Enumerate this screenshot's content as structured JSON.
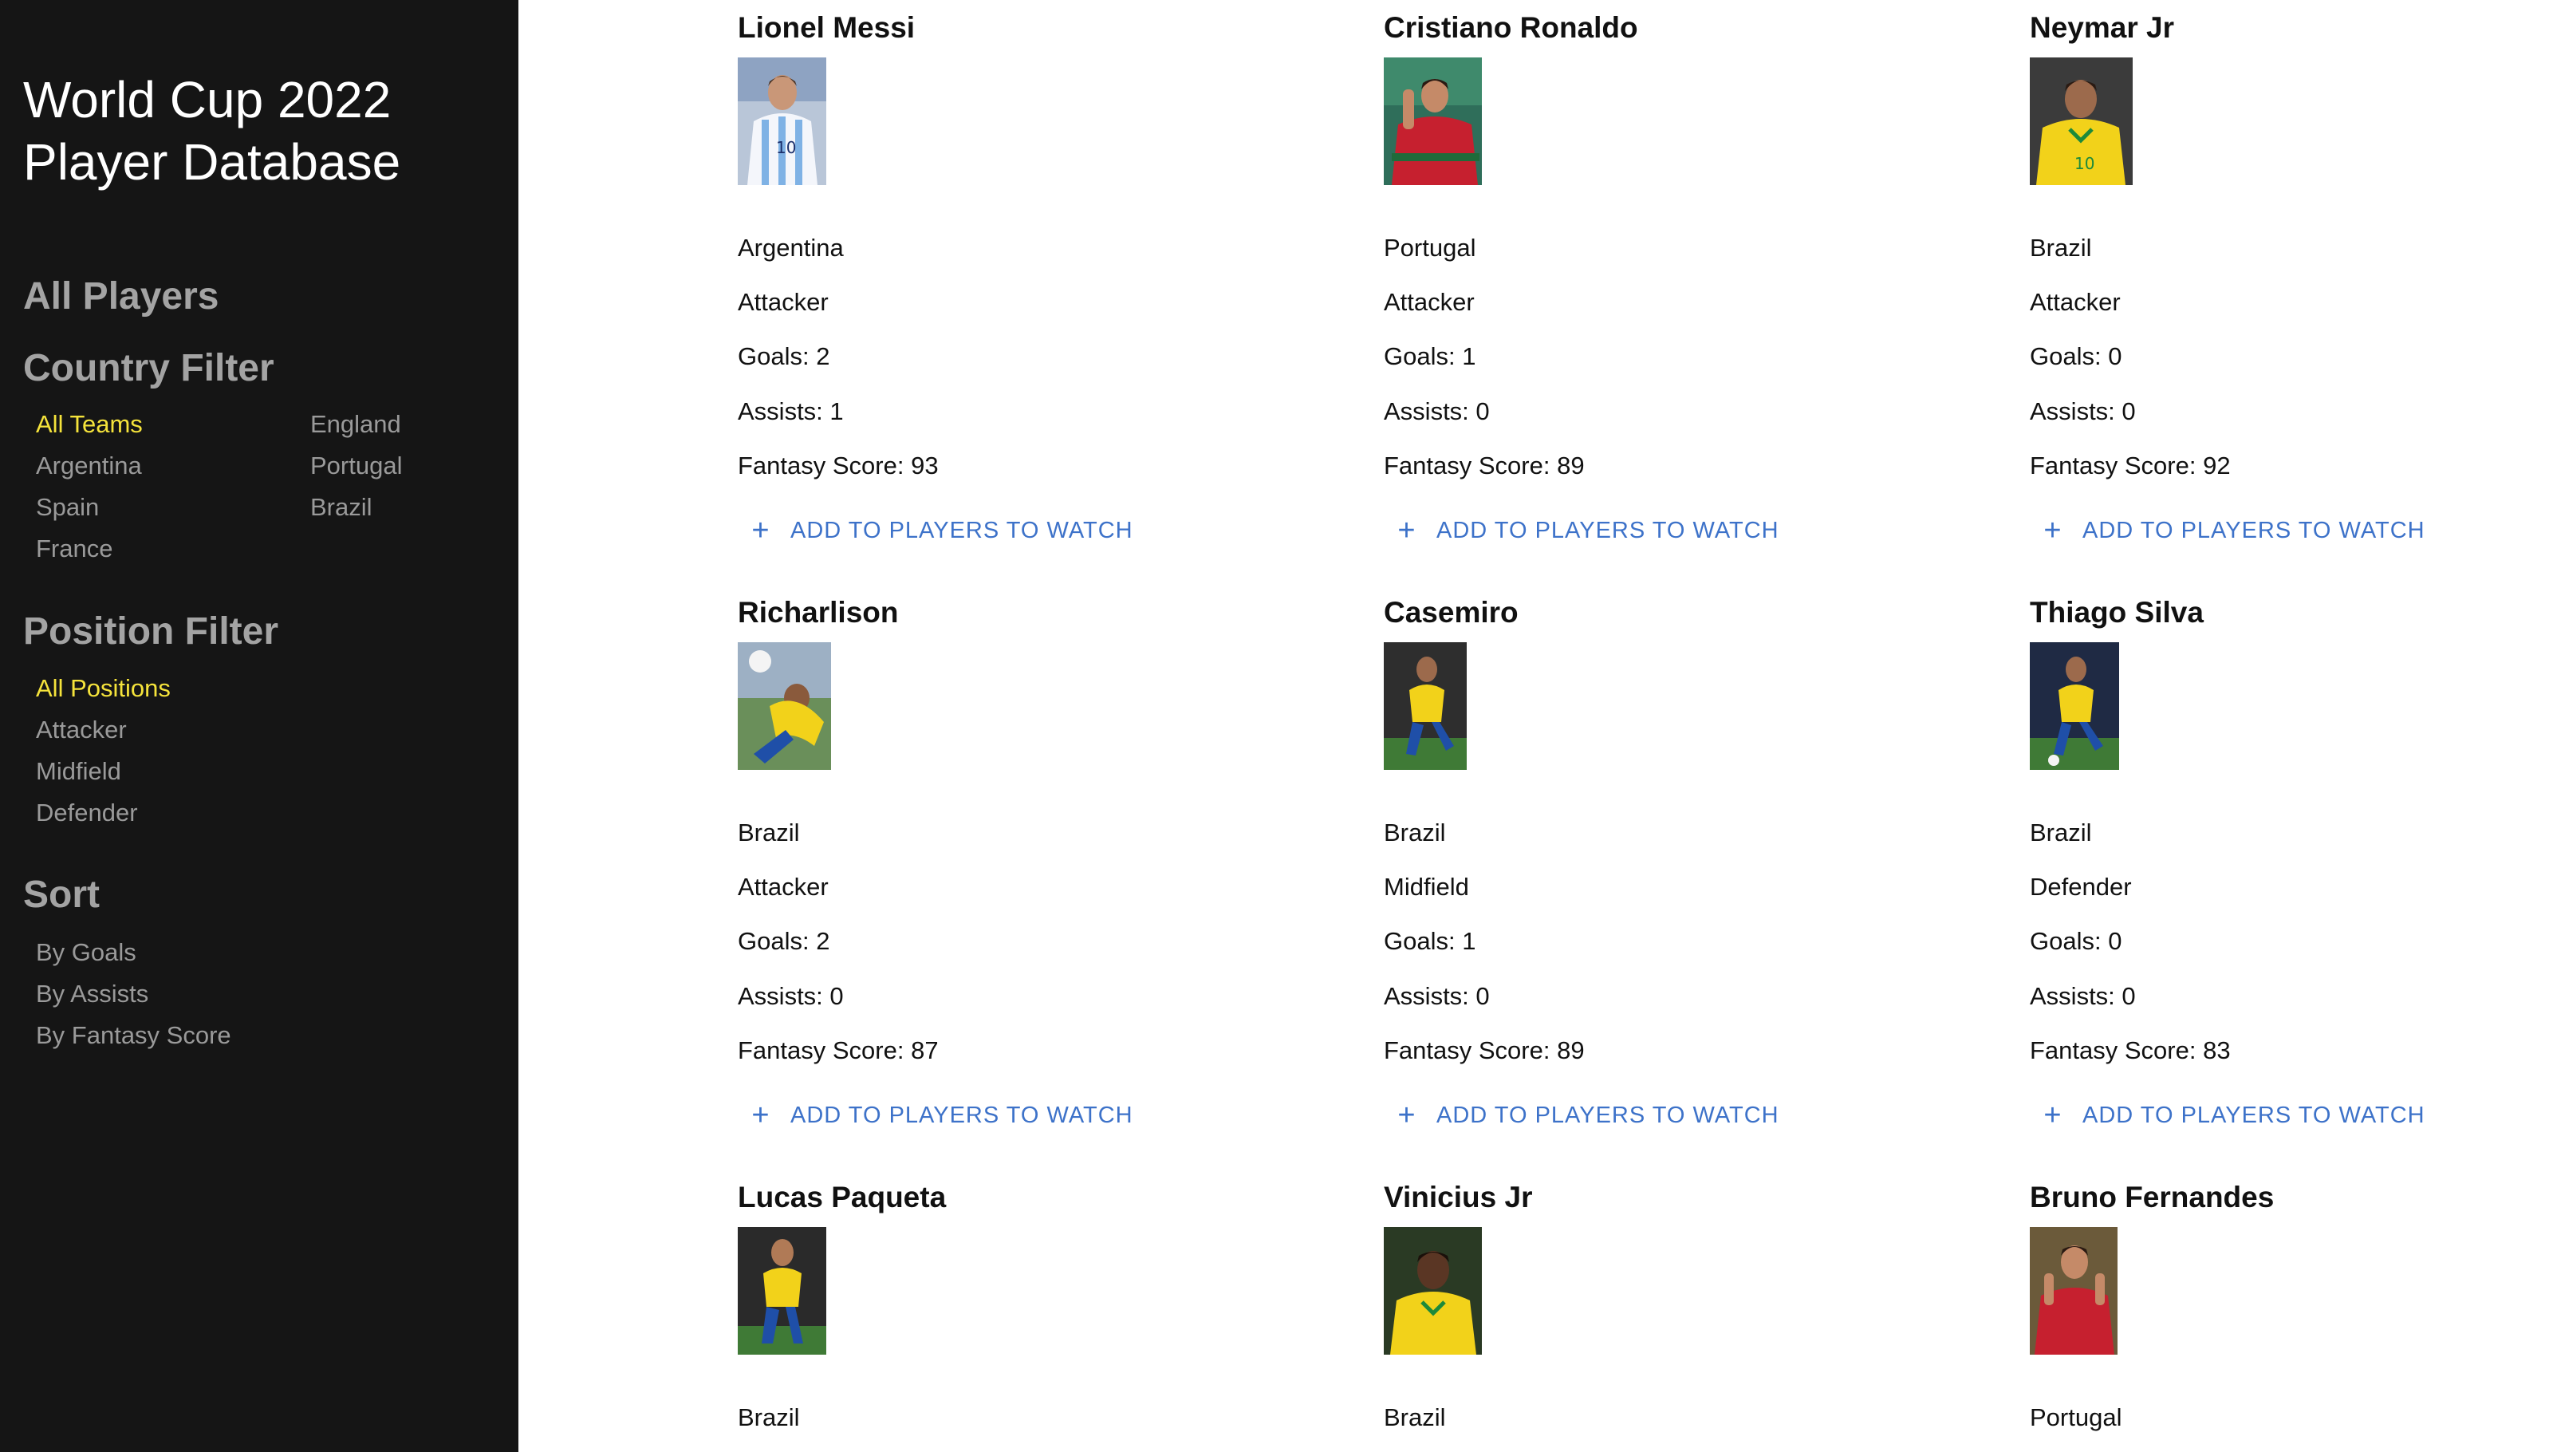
{
  "sidebar": {
    "title_line1": "World Cup 2022",
    "title_line2": "Player Database",
    "all_players": "All Players",
    "country_filter": {
      "heading": "Country Filter",
      "options": [
        "All Teams",
        "Argentina",
        "Spain",
        "France",
        "England",
        "Portugal",
        "Brazil"
      ],
      "selected": "All Teams"
    },
    "position_filter": {
      "heading": "Position Filter",
      "options": [
        "All Positions",
        "Attacker",
        "Midfield",
        "Defender"
      ],
      "selected": "All Positions"
    },
    "sort": {
      "heading": "Sort",
      "options": [
        "By Goals",
        "By Assists",
        "By Fantasy Score"
      ]
    }
  },
  "colors": {
    "sidebar_bg": "#151515",
    "active_link": "#f5e33b",
    "inactive_link": "#9a9a9a",
    "action_blue": "#3d72c9"
  },
  "players": [
    {
      "name": "Lionel Messi",
      "country": "Argentina",
      "position": "Attacker",
      "goals": "Goals: 2",
      "assists": "Assists: 1",
      "fantasy": "Fantasy Score: 93",
      "action": "ADD TO PLAYERS TO WATCH",
      "action_icon": "plus-icon",
      "photo_icon": "player-photo"
    },
    {
      "name": "Cristiano Ronaldo",
      "country": "Portugal",
      "position": "Attacker",
      "goals": "Goals: 1",
      "assists": "Assists: 0",
      "fantasy": "Fantasy Score: 89",
      "action": "ADD TO PLAYERS TO WATCH",
      "action_icon": "plus-icon",
      "photo_icon": "player-photo"
    },
    {
      "name": "Neymar Jr",
      "country": "Brazil",
      "position": "Attacker",
      "goals": "Goals: 0",
      "assists": "Assists: 0",
      "fantasy": "Fantasy Score: 92",
      "action": "ADD TO PLAYERS TO WATCH",
      "action_icon": "plus-icon",
      "photo_icon": "player-photo"
    },
    {
      "name": "Richarlison",
      "country": "Brazil",
      "position": "Attacker",
      "goals": "Goals: 2",
      "assists": "Assists: 0",
      "fantasy": "Fantasy Score: 87",
      "action": "ADD TO PLAYERS TO WATCH",
      "action_icon": "plus-icon",
      "photo_icon": "player-photo"
    },
    {
      "name": "Casemiro",
      "country": "Brazil",
      "position": "Midfield",
      "goals": "Goals: 1",
      "assists": "Assists: 0",
      "fantasy": "Fantasy Score: 89",
      "action": "ADD TO PLAYERS TO WATCH",
      "action_icon": "plus-icon",
      "photo_icon": "player-photo"
    },
    {
      "name": "Thiago Silva",
      "country": "Brazil",
      "position": "Defender",
      "goals": "Goals: 0",
      "assists": "Assists: 0",
      "fantasy": "Fantasy Score: 83",
      "action": "ADD TO PLAYERS TO WATCH",
      "action_icon": "plus-icon",
      "photo_icon": "player-photo"
    },
    {
      "name": "Lucas Paqueta",
      "country": "Brazil",
      "photo_icon": "player-photo"
    },
    {
      "name": "Vinicius Jr",
      "country": "Brazil",
      "photo_icon": "player-photo"
    },
    {
      "name": "Bruno Fernandes",
      "country": "Portugal",
      "photo_icon": "player-photo"
    }
  ]
}
